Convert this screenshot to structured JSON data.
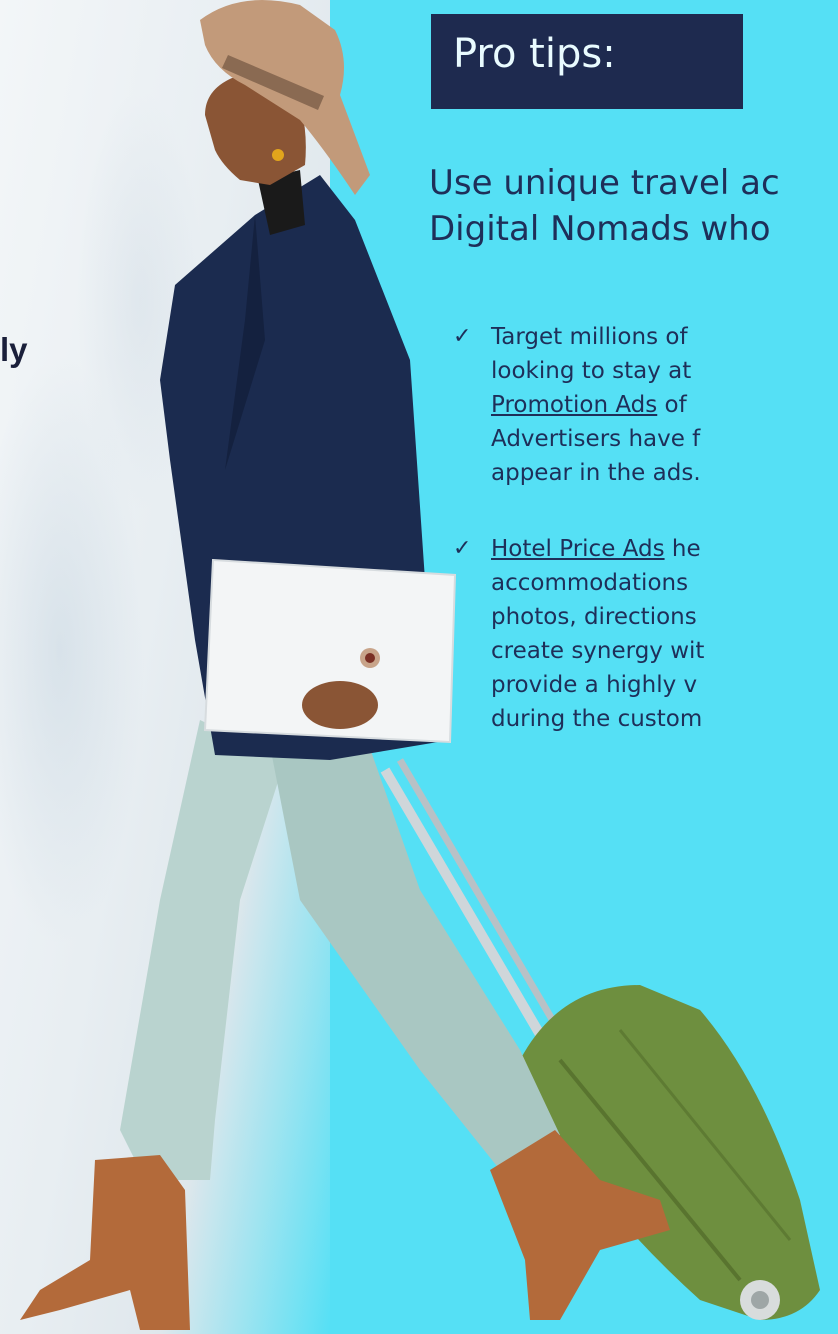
{
  "left_text": "ly",
  "title": "Pro tips:",
  "intro_lines": [
    "Use unique travel ac",
    "Digital Nomads who"
  ],
  "tips": [
    {
      "lines": [
        {
          "segments": [
            {
              "text": "Target millions of",
              "underline": false
            }
          ]
        },
        {
          "segments": [
            {
              "text": "looking to stay at",
              "underline": false
            }
          ]
        },
        {
          "segments": [
            {
              "text": "Promotion Ads",
              "underline": true
            },
            {
              "text": " of",
              "underline": false
            }
          ]
        },
        {
          "segments": [
            {
              "text": "Advertisers have f",
              "underline": false
            }
          ]
        },
        {
          "segments": [
            {
              "text": "appear in the ads.",
              "underline": false
            }
          ]
        }
      ]
    },
    {
      "lines": [
        {
          "segments": [
            {
              "text": "Hotel Price Ads",
              "underline": true
            },
            {
              "text": " he",
              "underline": false
            }
          ]
        },
        {
          "segments": [
            {
              "text": "accommodations",
              "underline": false
            }
          ]
        },
        {
          "segments": [
            {
              "text": "photos, directions",
              "underline": false
            }
          ]
        },
        {
          "segments": [
            {
              "text": "create synergy wit",
              "underline": false
            }
          ]
        },
        {
          "segments": [
            {
              "text": "provide a highly v",
              "underline": false
            }
          ]
        },
        {
          "segments": [
            {
              "text": "during the custom",
              "underline": false
            }
          ]
        }
      ]
    }
  ],
  "check_glyph": "✓",
  "colors": {
    "background": "#55e0f5",
    "title_box": "#1e2a4f",
    "title_text": "#e9fbff",
    "body_text": "#1e2f59"
  }
}
